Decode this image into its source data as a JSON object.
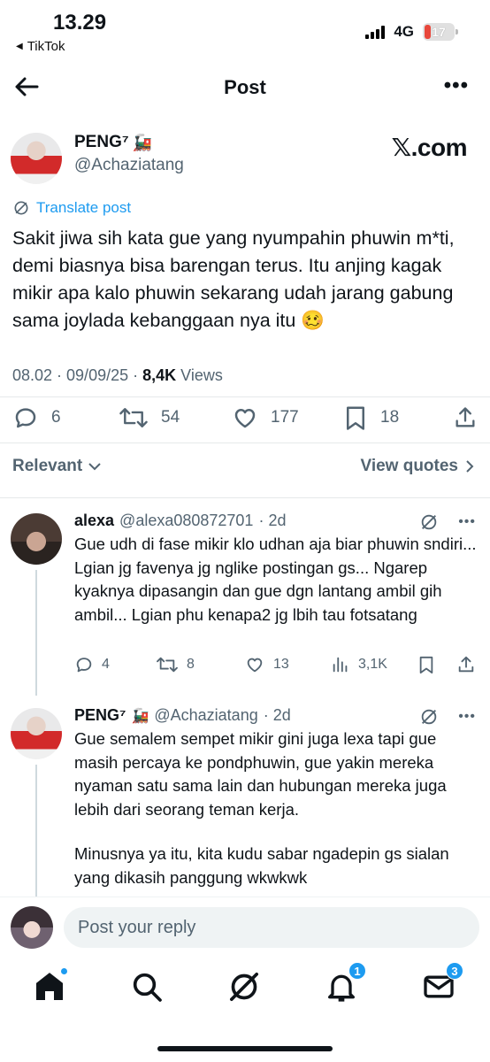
{
  "status_bar": {
    "time": "13.29",
    "back_app": "TikTok",
    "network": "4G",
    "battery": "17"
  },
  "header": {
    "title": "Post",
    "more": "•••"
  },
  "post": {
    "name": "PENG⁷",
    "emoji": "🚂",
    "handle": "@Achaziatang",
    "source_mark": "𝕏.com",
    "translate": "Translate post",
    "text": "Sakit jiwa sih kata gue yang nyumpahin phuwin m*ti, demi biasnya bisa barengan terus. Itu anjing kagak mikir apa kalo phuwin sekarang udah jarang gabung sama joylada kebanggaan nya itu 🥴",
    "timestamp": "08.02 · 09/09/25 · ",
    "views_count": "8,4K",
    "views_label": " Views",
    "counts": {
      "replies": "6",
      "reposts": "54",
      "likes": "177",
      "bookmarks": "18"
    }
  },
  "sort": {
    "relevant": "Relevant",
    "view_quotes": "View quotes"
  },
  "replies": [
    {
      "name": "alexa",
      "handle": "@alexa080872701",
      "time": "· 2d",
      "text": "Gue udh di fase mikir klo udhan aja biar phuwin sndiri... Lgian jg favenya jg nglike postingan gs... Ngarep kyaknya dipasangin dan gue dgn lantang ambil gih ambil... Lgian phu kenapa2  jg lbih tau fotsatang",
      "counts": {
        "replies": "4",
        "reposts": "8",
        "likes": "13",
        "views": "3,1K"
      }
    },
    {
      "name": "PENG⁷",
      "emoji": "🚂",
      "handle": "@Achaziatang",
      "time": "· 2d",
      "text_1": "Gue semalem sempet mikir gini juga lexa tapi gue masih percaya ke pondphuwin, gue yakin mereka nyaman satu sama lain dan hubungan mereka juga lebih dari seorang teman kerja.",
      "text_2": "Minusnya ya itu, kita kudu sabar ngadepin gs sialan yang dikasih panggung wkwkwk"
    }
  ],
  "reply_box": {
    "placeholder": "Post your reply"
  },
  "tabbar": {
    "notifications_badge": "1",
    "messages_badge": "3"
  },
  "colors": {
    "accent": "#1d9bf0",
    "text": "#0f1419",
    "secondary": "#536471"
  }
}
